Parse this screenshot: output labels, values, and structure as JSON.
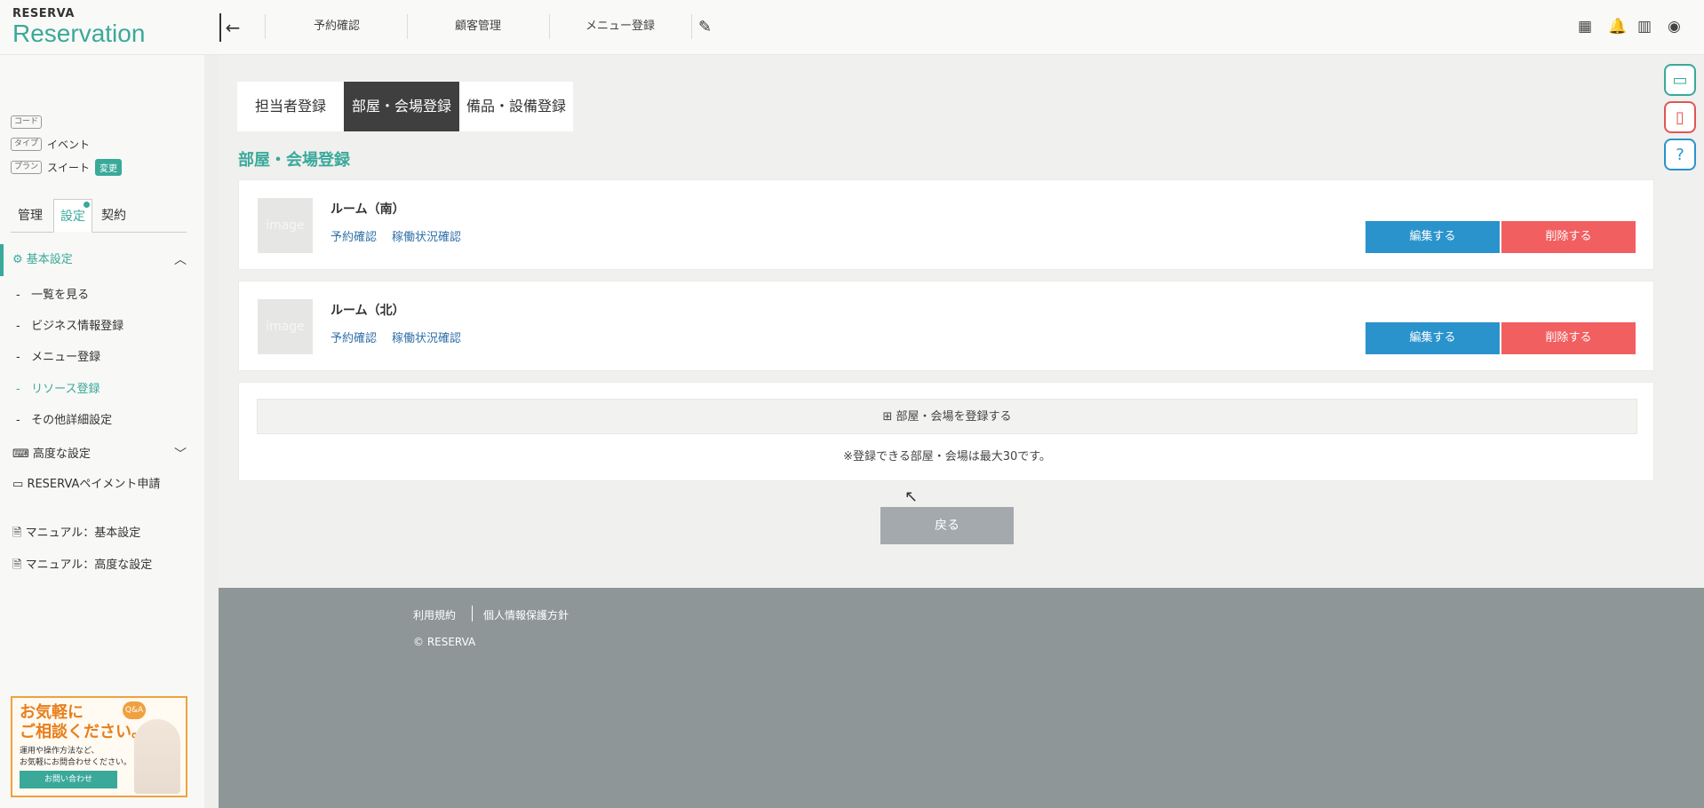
{
  "brand": {
    "small": "RESERVA",
    "big": "Reservation"
  },
  "header": {
    "back_icon": "←",
    "nav": [
      "予約確認",
      "顧客管理",
      "メニュー登録"
    ],
    "edit_icon": "✎",
    "icons": {
      "grid": "▦",
      "bell": "🔔",
      "building": "▥",
      "user": "◉"
    }
  },
  "sidebar": {
    "code_tag": "コード",
    "type_tag": "タイプ",
    "type_value": "イベント",
    "plan_tag": "プラン",
    "plan_value": "スイート",
    "change_label": "変更",
    "tabs": [
      "管理",
      "設定",
      "契約"
    ],
    "basic_settings": "基本設定",
    "sub_items": [
      "一覧を見る",
      "ビジネス情報登録",
      "メニュー登録",
      "リソース登録",
      "その他詳細設定"
    ],
    "advanced_settings": "高度な設定",
    "payment": "RESERVAペイメント申請",
    "manual_basic": "マニュアル：基本設定",
    "manual_advanced": "マニュアル：高度な設定",
    "banner": {
      "title1": "お気軽に",
      "title2": "ご相談ください。",
      "desc1": "運用や操作方法など、",
      "desc2": "お気軽にお問合わせください。",
      "qa": "Q&A",
      "button": "お問い合わせ"
    }
  },
  "resource_tabs": [
    "担当者登録",
    "部屋・会場登録",
    "備品・設備登録"
  ],
  "section_title": "部屋・会場登録",
  "rooms": [
    {
      "image": "image",
      "name": "ルーム（南）",
      "link1": "予約確認",
      "link2": "稼働状況確認",
      "edit": "編集する",
      "delete": "削除する"
    },
    {
      "image": "image",
      "name": "ルーム（北）",
      "link1": "予約確認",
      "link2": "稼働状況確認",
      "edit": "編集する",
      "delete": "削除する"
    }
  ],
  "add_button": "⊞ 部屋・会場を登録する",
  "add_note": "※登録できる部屋・会場は最大30です。",
  "back_button": "戻る",
  "footer": {
    "terms": "利用規約",
    "privacy": "個人情報保護方針",
    "copyright": "© RESERVA"
  },
  "colors": {
    "accent": "#3aa99a",
    "edit": "#2a93cc",
    "delete": "#f25f60",
    "footer": "#8e9697"
  }
}
